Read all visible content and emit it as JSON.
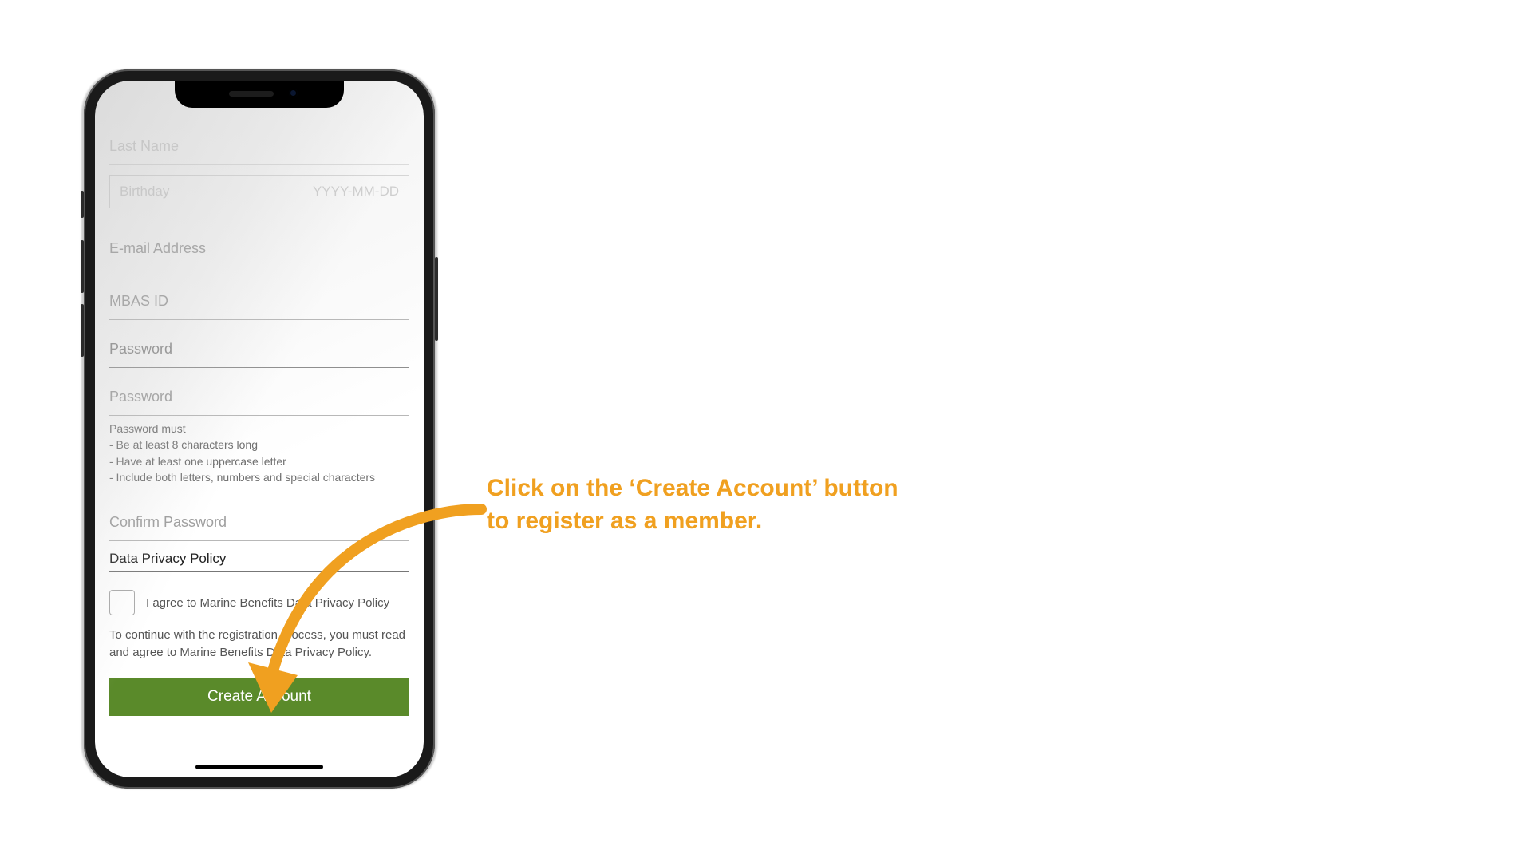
{
  "form": {
    "last_name_label": "Last Name",
    "birthday_left": "Birthday",
    "birthday_right": "YYYY-MM-DD",
    "email_label": "E-mail Address",
    "mbas_label": "MBAS ID",
    "password_label": "Password",
    "password2_label": "Password",
    "hint_title": "Password must",
    "hint_1": "- Be at least 8 characters long",
    "hint_2": "- Have at least one uppercase letter",
    "hint_3": "- Include both letters, numbers and special characters",
    "confirm_label": "Confirm Password",
    "privacy_title": "Data Privacy Policy",
    "agree_text": "I agree to Marine Benefits Data Privacy Policy",
    "continue_text": "To continue with the registration process, you must read and agree to Marine Benefits Data Privacy Policy.",
    "create_label": "Create Account"
  },
  "callout": {
    "line1": "Click on the ‘Create Account’ button",
    "line2": "to register as a member."
  }
}
